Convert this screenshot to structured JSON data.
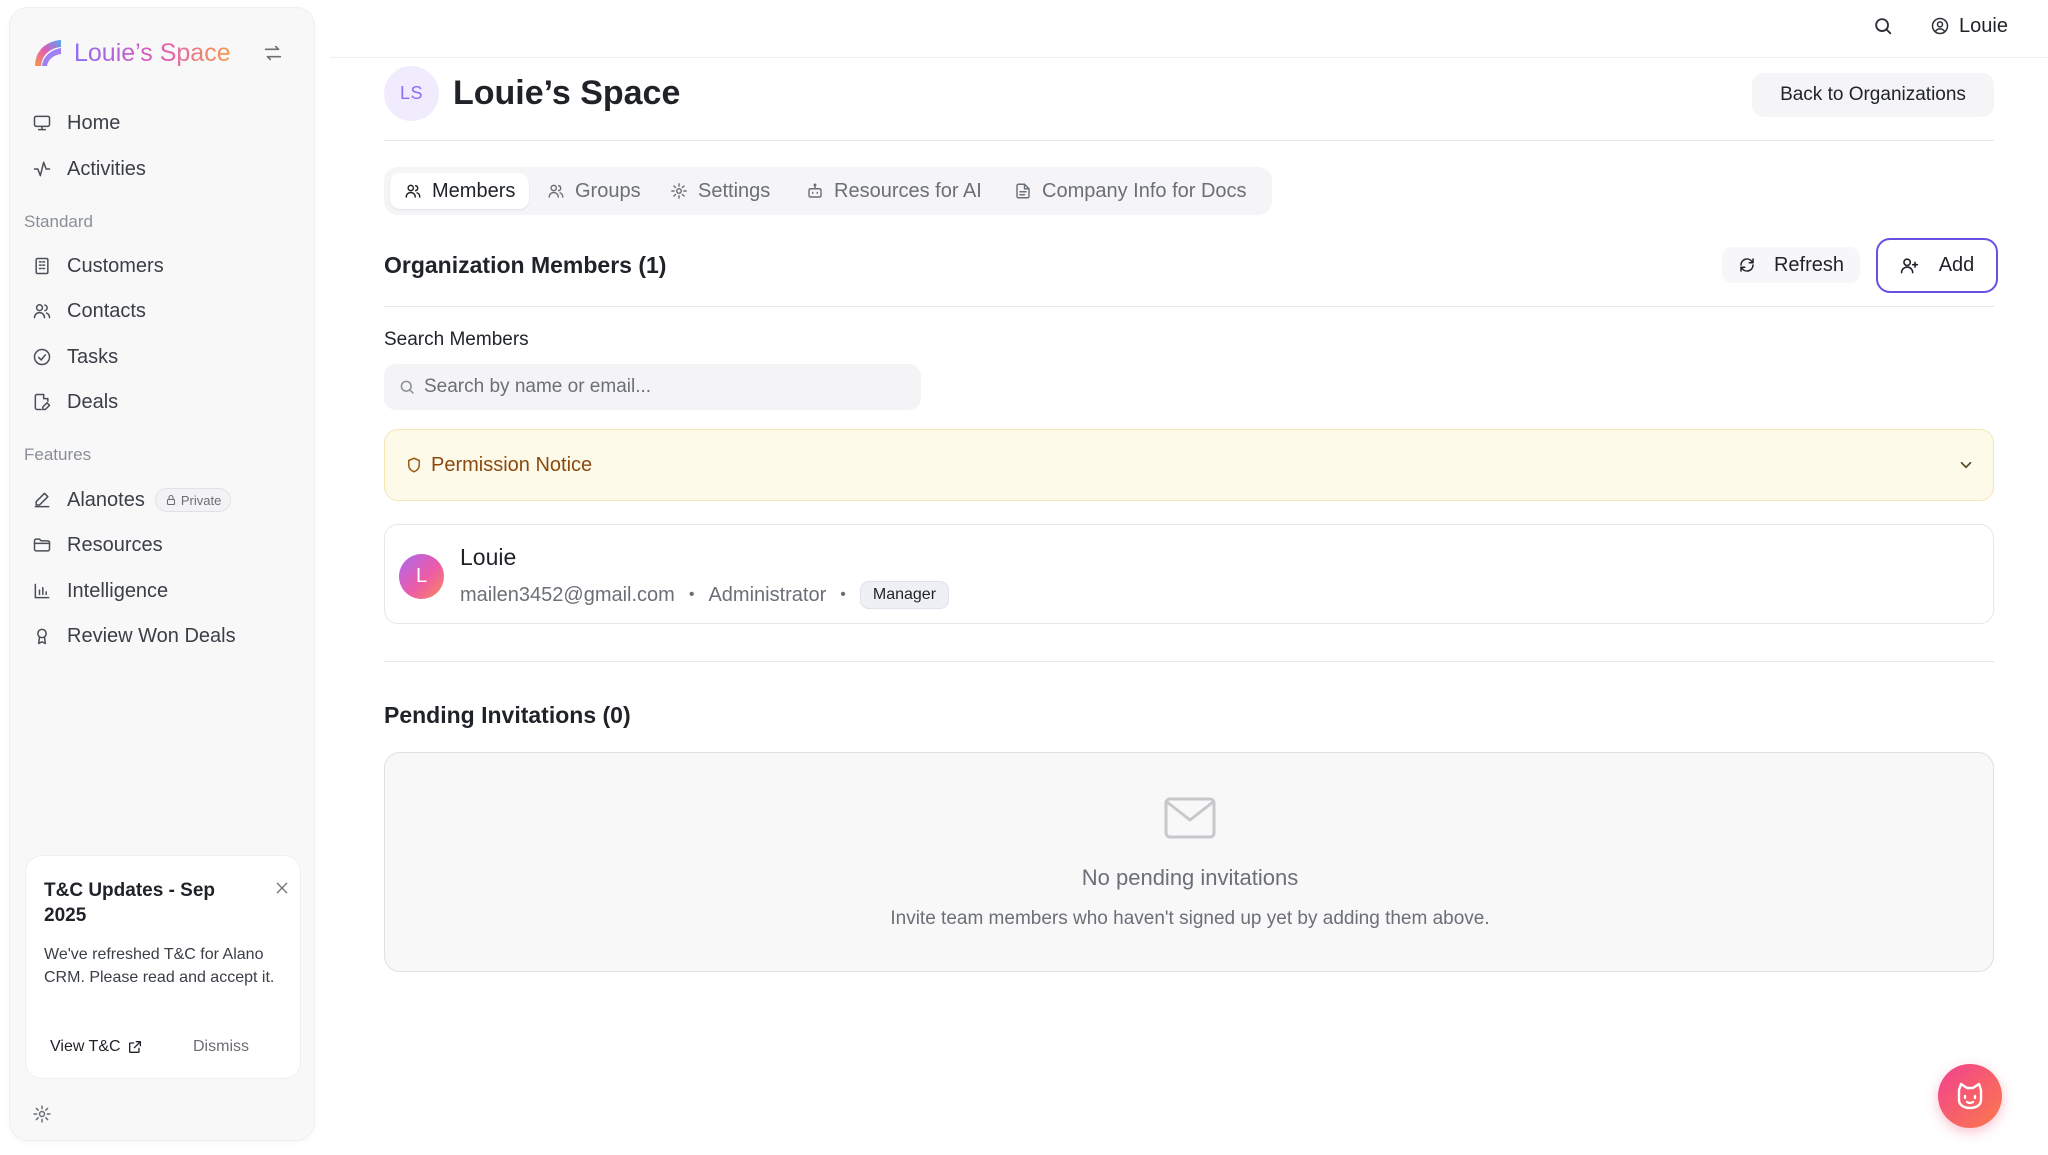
{
  "sidebar": {
    "brand": "Louie’s Space",
    "nav_top": [
      {
        "label": "Home",
        "icon": "monitor-icon"
      },
      {
        "label": "Activities",
        "icon": "activity-icon"
      }
    ],
    "standard_label": "Standard",
    "standard": [
      {
        "label": "Customers",
        "icon": "building-icon"
      },
      {
        "label": "Contacts",
        "icon": "users-icon"
      },
      {
        "label": "Tasks",
        "icon": "check-circle-icon"
      },
      {
        "label": "Deals",
        "icon": "file-edit-icon"
      }
    ],
    "features_label": "Features",
    "features": [
      {
        "label": "Alanotes",
        "icon": "pen-icon",
        "badge": "Private"
      },
      {
        "label": "Resources",
        "icon": "folder-icon"
      },
      {
        "label": "Intelligence",
        "icon": "bar-chart-icon"
      },
      {
        "label": "Review Won Deals",
        "icon": "award-icon"
      }
    ],
    "tc_card": {
      "title": "T&C Updates - Sep 2025",
      "body": "We've refreshed T&C for Alano CRM. Please read and accept it.",
      "view_label": "View T&C",
      "dismiss_label": "Dismiss"
    }
  },
  "topbar": {
    "user_name": "Louie"
  },
  "header": {
    "avatar_initials": "LS",
    "title": "Louie’s Space",
    "back_label": "Back to Organizations"
  },
  "tabs": [
    {
      "label": "Members",
      "icon": "users-icon",
      "active": true
    },
    {
      "label": "Groups",
      "icon": "users-icon",
      "active": false
    },
    {
      "label": "Settings",
      "icon": "gear-icon",
      "active": false
    },
    {
      "label": "Resources for AI",
      "icon": "bot-icon",
      "active": false
    },
    {
      "label": "Company Info for Docs",
      "icon": "document-icon",
      "active": false
    }
  ],
  "members": {
    "heading": "Organization Members (1)",
    "refresh_label": "Refresh",
    "add_label": "Add",
    "search_label": "Search Members",
    "search_placeholder": "Search by name or email...",
    "notice_title": "Permission Notice",
    "list": [
      {
        "initial": "L",
        "name": "Louie",
        "email": "mailen3452@gmail.com",
        "role": "Administrator",
        "badge": "Manager"
      }
    ]
  },
  "pending": {
    "heading": "Pending Invitations (0)",
    "empty_title": "No pending invitations",
    "empty_sub": "Invite team members who haven't signed up yet by adding them above."
  },
  "colors": {
    "accent": "#6b4fe0",
    "notice_bg": "#fefaea",
    "notice_text": "#8a4a0e"
  }
}
